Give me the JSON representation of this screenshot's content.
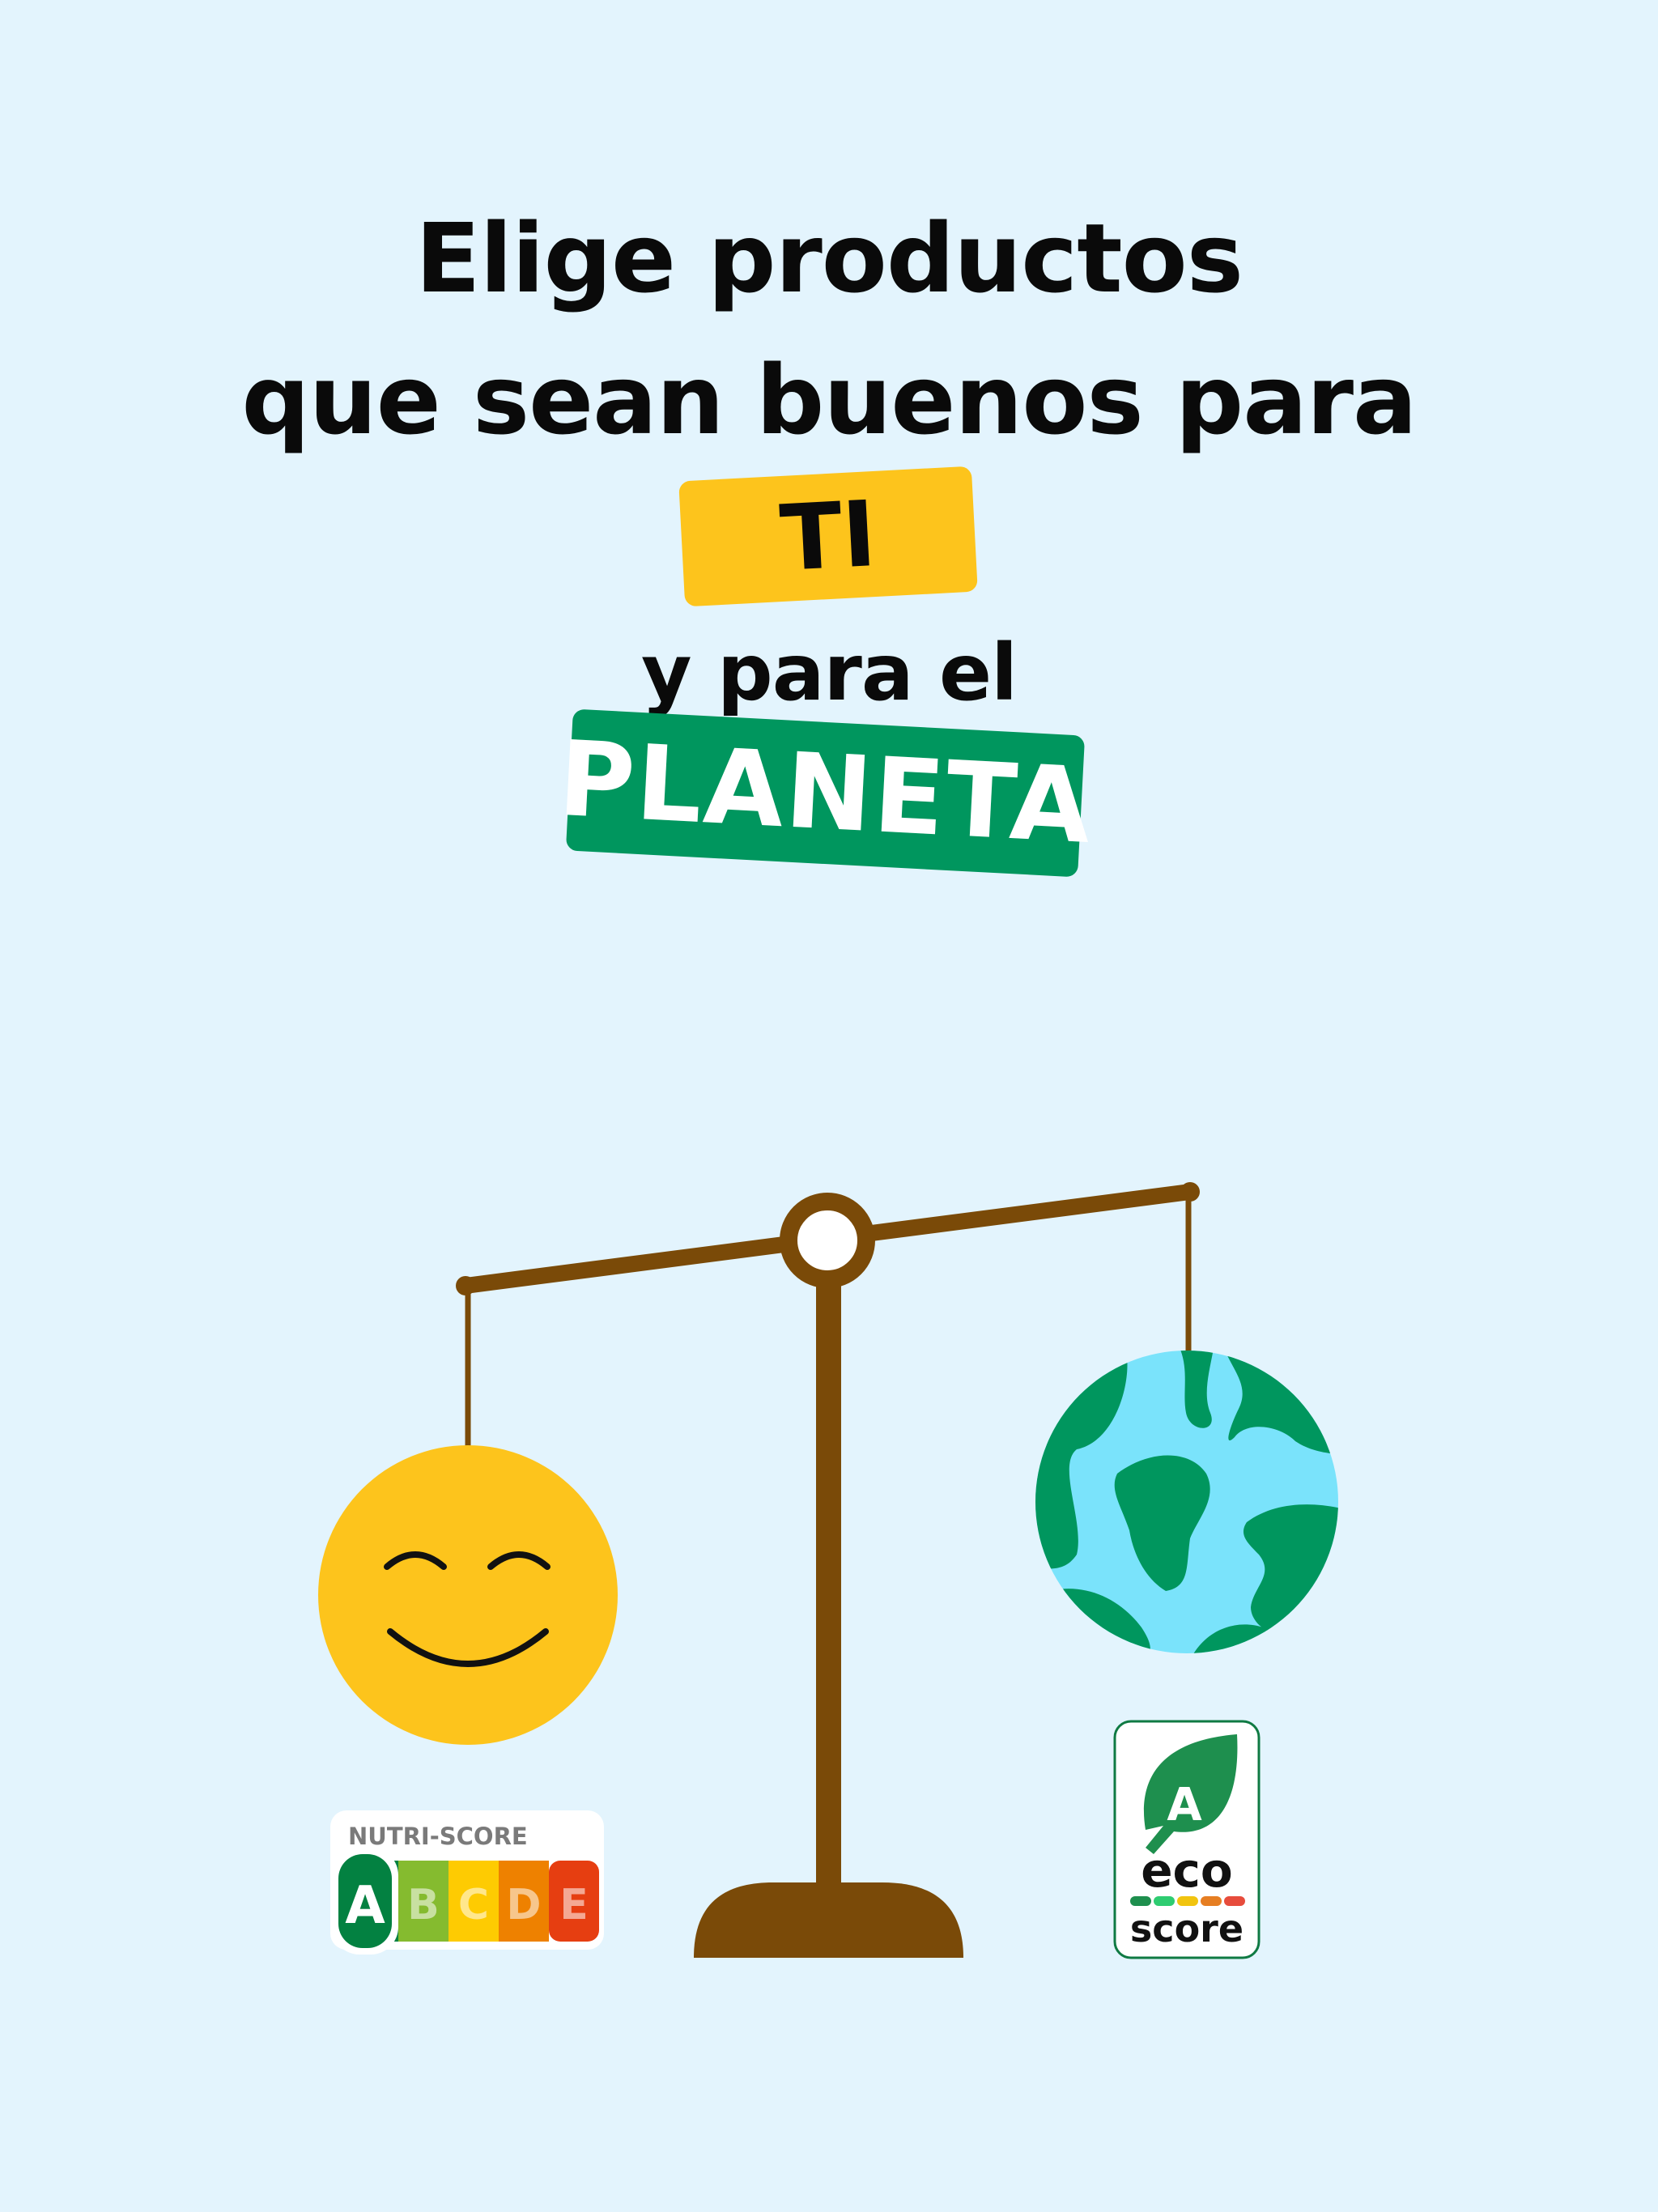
{
  "headline": {
    "line1": "Elige productos",
    "line2": "que sean buenos para",
    "highlight_you": "TI",
    "line3": "y para el",
    "highlight_planet": "PLANETA"
  },
  "nutri_score": {
    "title": "NUTRI-SCORE",
    "grades": [
      "A",
      "B",
      "C",
      "D",
      "E"
    ],
    "selected": "A",
    "colors": [
      "#038141",
      "#85bb2f",
      "#fecb02",
      "#ee8100",
      "#e63e11"
    ]
  },
  "eco_score": {
    "grade": "A",
    "line1": "eco",
    "line2": "score",
    "colors": [
      "#1e8f4e",
      "#2ecc71",
      "#f1c40f",
      "#e67e22",
      "#e74c3c"
    ]
  },
  "colors": {
    "background": "#e3f4fd",
    "accent_yellow": "#fdc41c",
    "accent_green": "#00965e",
    "scale_brown": "#7a4a08",
    "ocean": "#7ae3fb"
  },
  "icons": {
    "smiley": "smiley-face-icon",
    "globe": "earth-globe-icon",
    "scale": "balance-scale-icon"
  }
}
